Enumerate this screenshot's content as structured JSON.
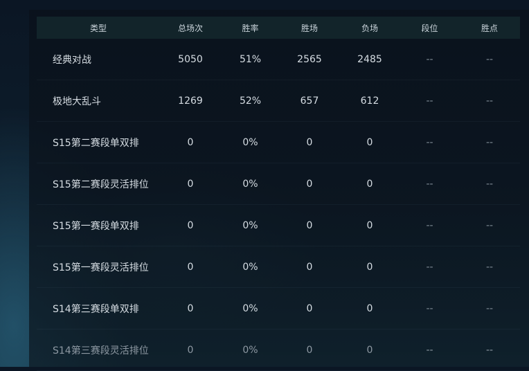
{
  "table": {
    "headers": [
      "类型",
      "总场次",
      "胜率",
      "胜场",
      "负场",
      "段位",
      "胜点"
    ],
    "rows": [
      [
        "经典对战",
        "5050",
        "51%",
        "2565",
        "2485",
        "--",
        "--"
      ],
      [
        "极地大乱斗",
        "1269",
        "52%",
        "657",
        "612",
        "--",
        "--"
      ],
      [
        "S15第二赛段单双排",
        "0",
        "0%",
        "0",
        "0",
        "--",
        "--"
      ],
      [
        "S15第二赛段灵活排位",
        "0",
        "0%",
        "0",
        "0",
        "--",
        "--"
      ],
      [
        "S15第一赛段单双排",
        "0",
        "0%",
        "0",
        "0",
        "--",
        "--"
      ],
      [
        "S15第一赛段灵活排位",
        "0",
        "0%",
        "0",
        "0",
        "--",
        "--"
      ],
      [
        "S14第三赛段单双排",
        "0",
        "0%",
        "0",
        "0",
        "--",
        "--"
      ],
      [
        "S14第三赛段灵活排位",
        "0",
        "0%",
        "0",
        "0",
        "--",
        "--"
      ]
    ]
  },
  "colors": {
    "header_background": "#12242a",
    "panel_background": "#0b141e",
    "text": "#d6dde3",
    "muted_text": "#7f8b95"
  }
}
